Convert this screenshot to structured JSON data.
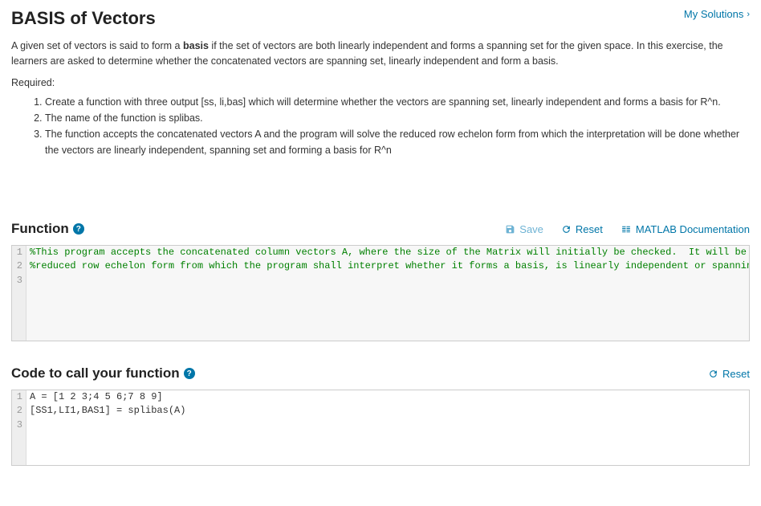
{
  "header": {
    "title": "BASIS of Vectors",
    "my_solutions": "My Solutions"
  },
  "description": {
    "part1": "A given set of vectors is said to form a ",
    "bold": "basis",
    "part2": " if the set of vectors are both linearly independent and forms a spanning set for the given space.  In this exercise, the learners are asked to determine whether the concatenated vectors are spanning set, linearly independent and form a basis."
  },
  "required_label": "Required:",
  "requirements": [
    "Create a function with three output [ss, li,bas] which will determine whether the vectors are spanning set, linearly independent and forms a basis for R^n.",
    "The name of the function is splibas.",
    "The function accepts the concatenated vectors A and the program will solve the reduced row echelon form from which the interpretation will be done whether the vectors are linearly independent, spanning set and forming a basis for R^n"
  ],
  "function_section": {
    "title": "Function",
    "toolbar": {
      "save": "Save",
      "reset": "Reset",
      "docs": "MATLAB Documentation"
    },
    "lines": [
      {
        "n": "1",
        "t": "%This program accepts the concatenated column vectors A, where the size of the Matrix will initially be checked.  It will be transformed into its",
        "cls": "comment"
      },
      {
        "n": "2",
        "t": "%reduced row echelon form from which the program shall interpret whether it forms a basis, is linearly independent or spanning set for R^n.",
        "cls": "comment"
      },
      {
        "n": "3",
        "t": "",
        "cls": ""
      }
    ]
  },
  "call_section": {
    "title": "Code to call your function",
    "toolbar": {
      "reset": "Reset"
    },
    "lines": [
      {
        "n": "1",
        "t": "A = [1 2 3;4 5 6;7 8 9]",
        "cls": ""
      },
      {
        "n": "2",
        "t": "[SS1,LI1,BAS1] = splibas(A)",
        "cls": ""
      },
      {
        "n": "3",
        "t": "",
        "cls": ""
      }
    ]
  }
}
